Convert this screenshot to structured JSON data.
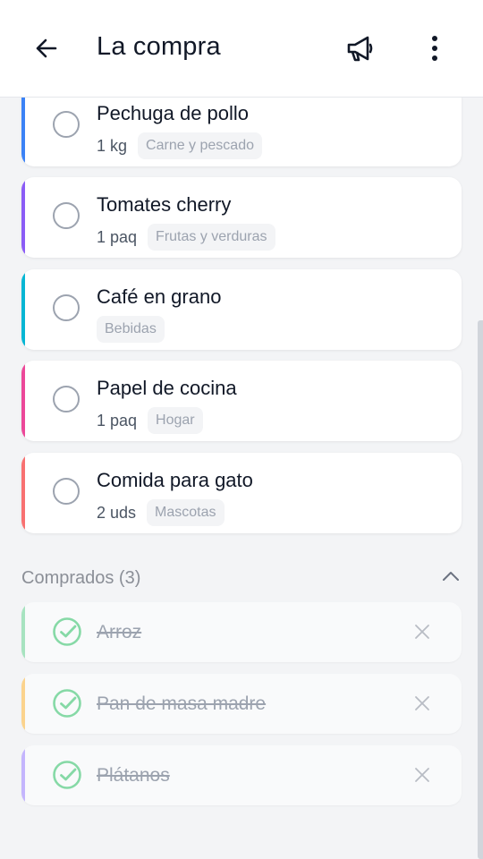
{
  "header": {
    "title": "La compra",
    "back_icon": "arrow-left-icon",
    "action_icon": "megaphone-icon",
    "menu_icon": "more-vertical-icon"
  },
  "pending": [
    {
      "name": "Pechuga de pollo",
      "qty": "1 kg",
      "category": "Carne y pescado",
      "color": "#3b82f6"
    },
    {
      "name": "Tomates cherry",
      "qty": "1 paq",
      "category": "Frutas y verduras",
      "color": "#8b5cf6"
    },
    {
      "name": "Café en grano",
      "qty": "",
      "category": "Bebidas",
      "color": "#06b6d4"
    },
    {
      "name": "Papel de cocina",
      "qty": "1 paq",
      "category": "Hogar",
      "color": "#ec4899"
    },
    {
      "name": "Comida para gato",
      "qty": "2 uds",
      "category": "Mascotas",
      "color": "#f87171"
    }
  ],
  "purchased": {
    "title": "Comprados (3)",
    "items": [
      {
        "name": "Arroz",
        "color": "#a7e3c0"
      },
      {
        "name": "Pan de masa madre",
        "color": "#fbd38d"
      },
      {
        "name": "Plátanos",
        "color": "#c4b5fd"
      }
    ]
  },
  "colors": {
    "check": "#86d9a6",
    "background": "#f3f4f6"
  }
}
